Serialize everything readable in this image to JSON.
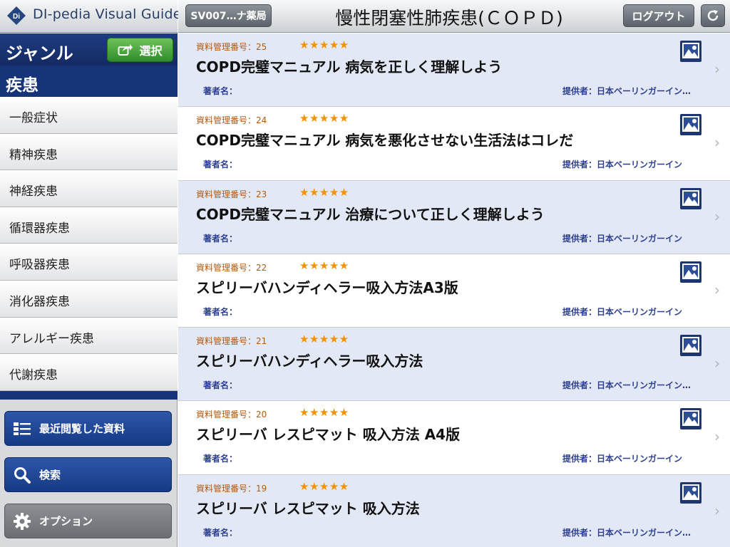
{
  "app": {
    "logo_text": "DI-pedia Visual Guide",
    "logo_mark": "Di"
  },
  "sidebar": {
    "genre_title": "ジャンル",
    "select_label": "選択",
    "current_genre": "疾患",
    "genres": [
      "一般症状",
      "精神疾患",
      "神経疾患",
      "循環器疾患",
      "呼吸器疾患",
      "消化器疾患",
      "アレルギー疾患",
      "代謝疾患"
    ],
    "recent_label": "最近閲覧した資料",
    "search_label": "検索",
    "options_label": "オプション"
  },
  "topbar": {
    "store_label": "SV007…ナ薬局",
    "title": "慢性閉塞性肺疾患(ＣＯＰＤ)",
    "logout_label": "ログアウト"
  },
  "documents": [
    {
      "id_label": "資料管理番号：25",
      "stars": "★★★★★",
      "title": "COPD完璧マニュアル 病気を正しく理解しよう",
      "author": "著者名：",
      "provider": "提供者：日本ベーリンガーイン…"
    },
    {
      "id_label": "資料管理番号：24",
      "stars": "★★★★★",
      "title": "COPD完璧マニュアル 病気を悪化させない生活法はコレだ",
      "author": "著者名：",
      "provider": "提供者：日本ベーリンガーイン"
    },
    {
      "id_label": "資料管理番号：23",
      "stars": "★★★★★",
      "title": "COPD完璧マニュアル 治療について正しく理解しよう",
      "author": "著者名：",
      "provider": "提供者：日本ベーリンガーイン"
    },
    {
      "id_label": "資料管理番号：22",
      "stars": "★★★★★",
      "title": "スピリーバハンディヘラー吸入方法A3版",
      "author": "著者名：",
      "provider": "提供者：日本ベーリンガーイン"
    },
    {
      "id_label": "資料管理番号：21",
      "stars": "★★★★★",
      "title": "スピリーバハンディヘラー吸入方法",
      "author": "著者名：",
      "provider": "提供者：日本ベーリンガーイン…"
    },
    {
      "id_label": "資料管理番号：20",
      "stars": "★★★★★",
      "title": "スピリーバ レスピマット 吸入方法 A4版",
      "author": "著者名：",
      "provider": "提供者：日本ベーリンガーイン"
    },
    {
      "id_label": "資料管理番号：19",
      "stars": "★★★★★",
      "title": "スピリーバ レスピマット 吸入方法",
      "author": "著者名：",
      "provider": "提供者：日本ベーリンガーイン…"
    }
  ],
  "colors": {
    "sidebar_blue": "#173479",
    "select_green": "#3fa034",
    "row_tint": "#e3e8f7",
    "star": "#f39200",
    "id_orange": "#b15a12",
    "meta_blue": "#2c3f93"
  },
  "icons": {
    "select": "share-out-icon",
    "recent": "list-icon",
    "search": "magnifier-icon",
    "options": "gear-icon",
    "refresh": "refresh-icon",
    "row_media": "image-icon",
    "row_disclosure": "chevron-right-icon"
  }
}
